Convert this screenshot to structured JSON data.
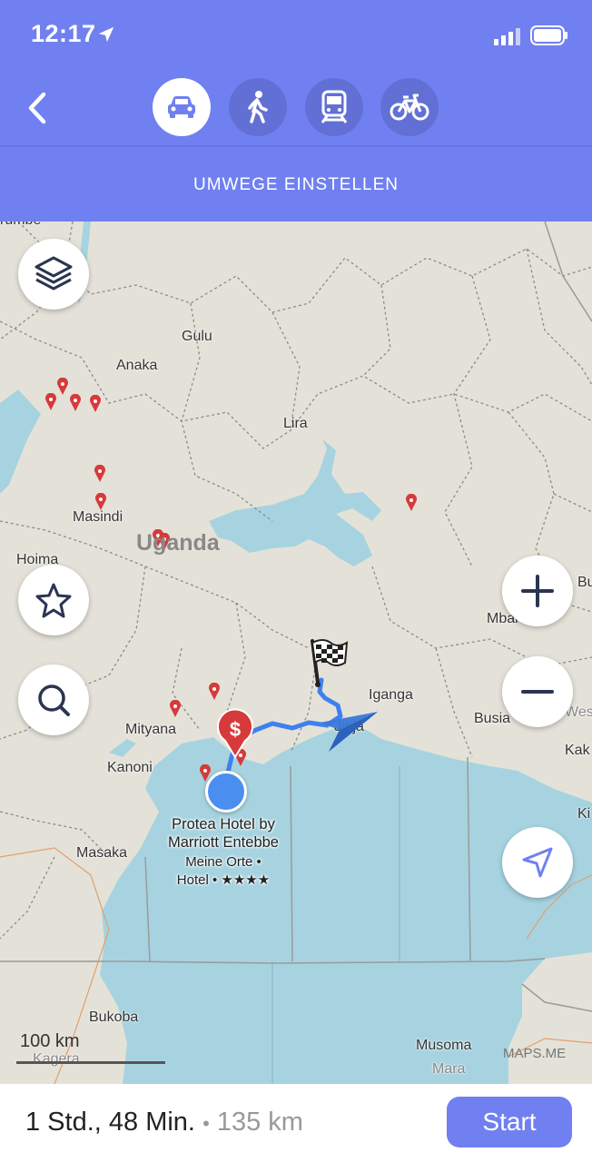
{
  "status": {
    "time": "12:17"
  },
  "header": {
    "modes": [
      {
        "name": "car",
        "active": true
      },
      {
        "name": "walk",
        "active": false
      },
      {
        "name": "transit",
        "active": false
      },
      {
        "name": "bike",
        "active": false
      }
    ],
    "detour_label": "UMWEGE EINSTELLEN"
  },
  "map": {
    "places": {
      "rumbe": "rumbe",
      "gulu": "Gulu",
      "anaka": "Anaka",
      "lira": "Lira",
      "masindi": "Masindi",
      "uganda": "Uganda",
      "hoima": "Hoima",
      "iganga": "Iganga",
      "mbale": "Mbal",
      "busia": "Busia",
      "mityana": "Mityana",
      "kanoni": "Kanoni",
      "masaka": "Masaka",
      "bukoba": "Bukoba",
      "kagera": "Kagera",
      "musoma": "Musoma",
      "mara": "Mara",
      "bu": "Bu",
      "kak": "Kak",
      "ki": "Ki",
      "west": "West",
      "jinja": "Jinja"
    },
    "hotel": {
      "name_line1": "Protea Hotel by",
      "name_line2": "Marriott Entebbe",
      "meta_line1": "Meine Orte •",
      "meta_line2": "Hotel • ★★★★"
    },
    "scale": "100 km",
    "watermark": "MAPS.ME",
    "icons": [
      "layers-icon",
      "star-icon",
      "search-icon",
      "plus-icon",
      "minus-icon",
      "navigate-icon",
      "finish-flag-icon",
      "dollar-icon"
    ]
  },
  "route": {
    "duration": "1 Std., 48 Min.",
    "separator": "•",
    "distance": "135 km",
    "start_label": "Start"
  },
  "colors": {
    "accent": "#7080f0",
    "water": "#a7d3e0",
    "land": "#e4e2d8",
    "route": "#3f80f0"
  }
}
